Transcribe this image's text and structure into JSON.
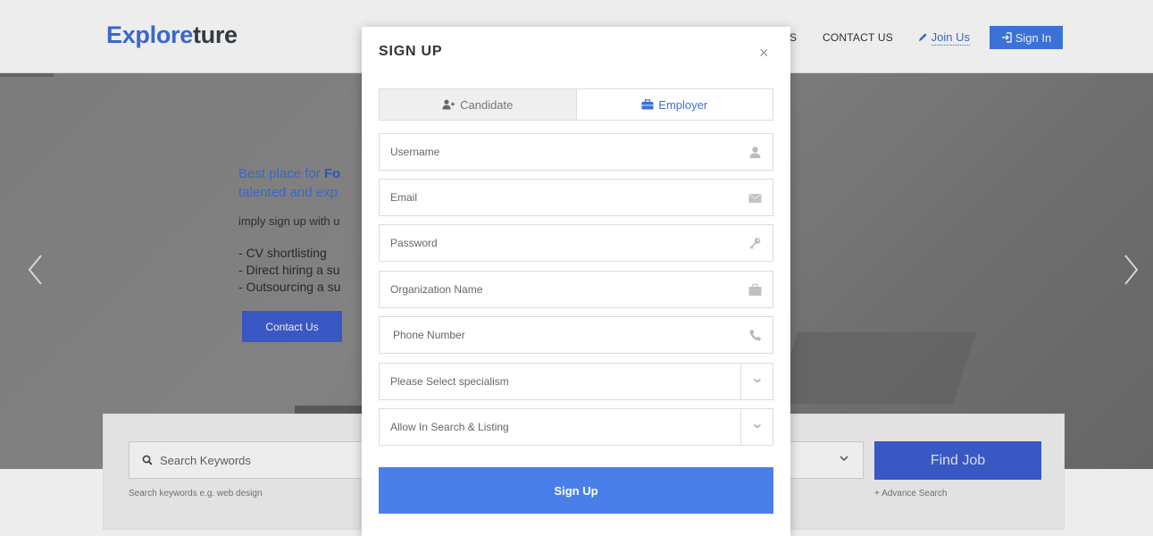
{
  "header": {
    "logo_part1": "Explore",
    "logo_part2": "ture",
    "nav_partial": "S",
    "nav_contact": "CONTACT US",
    "join_label": "Join Us",
    "signin_label": "Sign In"
  },
  "hero": {
    "line1_prefix": "Best place for ",
    "line1_bold": "Fo",
    "line2": "talented and exp",
    "subtext": "imply sign up with u",
    "list": [
      "- CV shortlisting",
      "- Direct hiring a su",
      "- Outsourcing a su"
    ],
    "contact_button": "Contact Us"
  },
  "search": {
    "placeholder": "Search Keywords",
    "hint": "Search keywords e.g. web design",
    "find_button": "Find Job",
    "advance_link": "+ Advance Search"
  },
  "modal": {
    "title": "SIGN UP",
    "close": "×",
    "tabs": [
      {
        "label": "Candidate",
        "active": false
      },
      {
        "label": "Employer",
        "active": true
      }
    ],
    "fields": {
      "username": "Username",
      "email": "Email",
      "password": "Password",
      "organization": "Organization Name",
      "phone": "Phone Number",
      "specialism": "Please Select specialism",
      "allow_search": "Allow In Search & Listing"
    },
    "submit": "Sign Up"
  },
  "colors": {
    "brand_blue": "#3f6fdc",
    "button_blue": "#4a7fea",
    "dark_button": "#3f5fd2"
  }
}
